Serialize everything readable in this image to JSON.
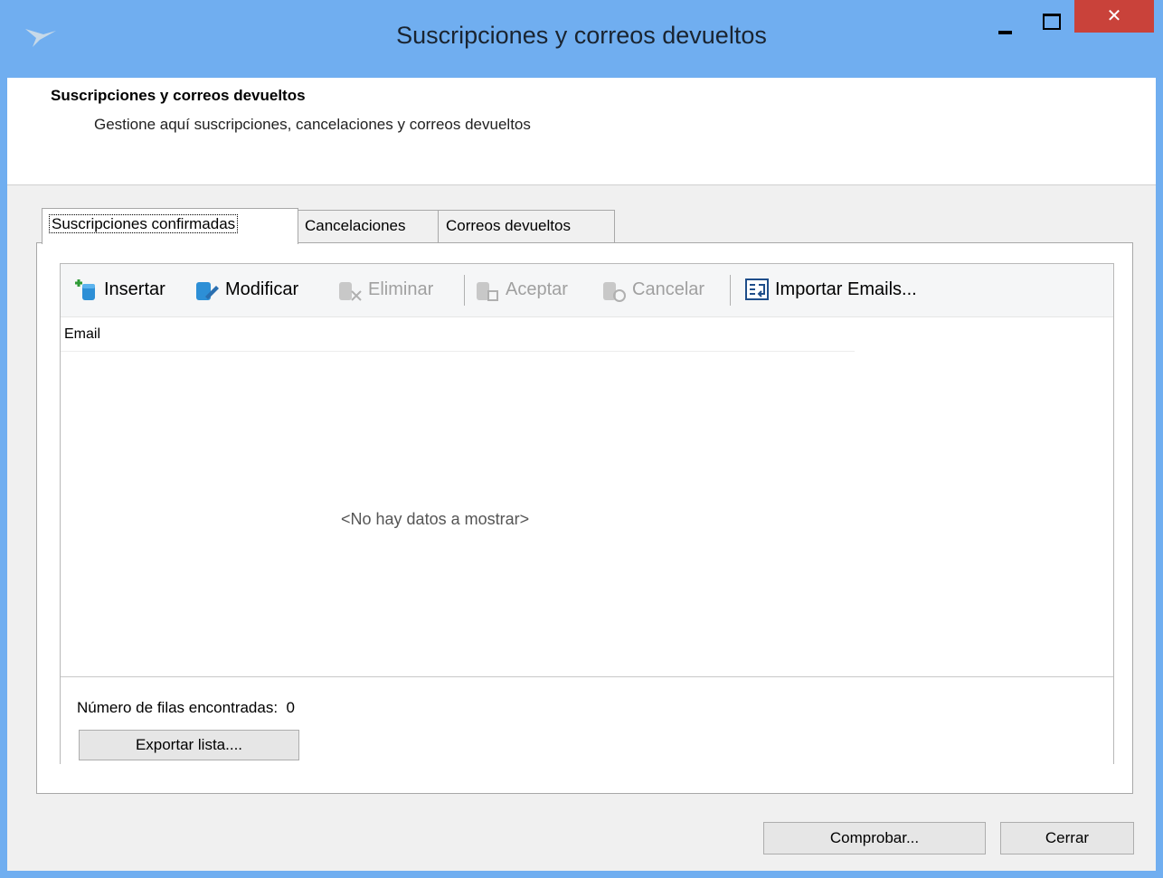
{
  "window": {
    "title": "Suscripciones y correos devueltos",
    "close_label": "✕"
  },
  "header": {
    "title": "Suscripciones y correos devueltos",
    "subtitle": "Gestione aquí suscripciones, cancelaciones y correos devueltos"
  },
  "tabs": [
    {
      "label": "Suscripciones confirmadas",
      "active": true
    },
    {
      "label": "Cancelaciones",
      "active": false
    },
    {
      "label": "Correos devueltos",
      "active": false
    }
  ],
  "toolbar": {
    "insert_label": "Insertar",
    "modify_label": "Modificar",
    "delete_label": "Eliminar",
    "accept_label": "Aceptar",
    "cancel_label": "Cancelar",
    "import_label": "Importar Emails..."
  },
  "grid": {
    "columns": [
      "Email"
    ],
    "empty_message": "<No hay datos a mostrar>",
    "rows_found_label": "Número de filas encontradas:",
    "rows_found_count": "0"
  },
  "buttons": {
    "export": "Exportar lista....",
    "check": "Comprobar...",
    "close": "Cerrar"
  },
  "colors": {
    "titlebar": "#70aef0",
    "close_button": "#c9423a",
    "icon_blue": "#2d8fd6"
  }
}
